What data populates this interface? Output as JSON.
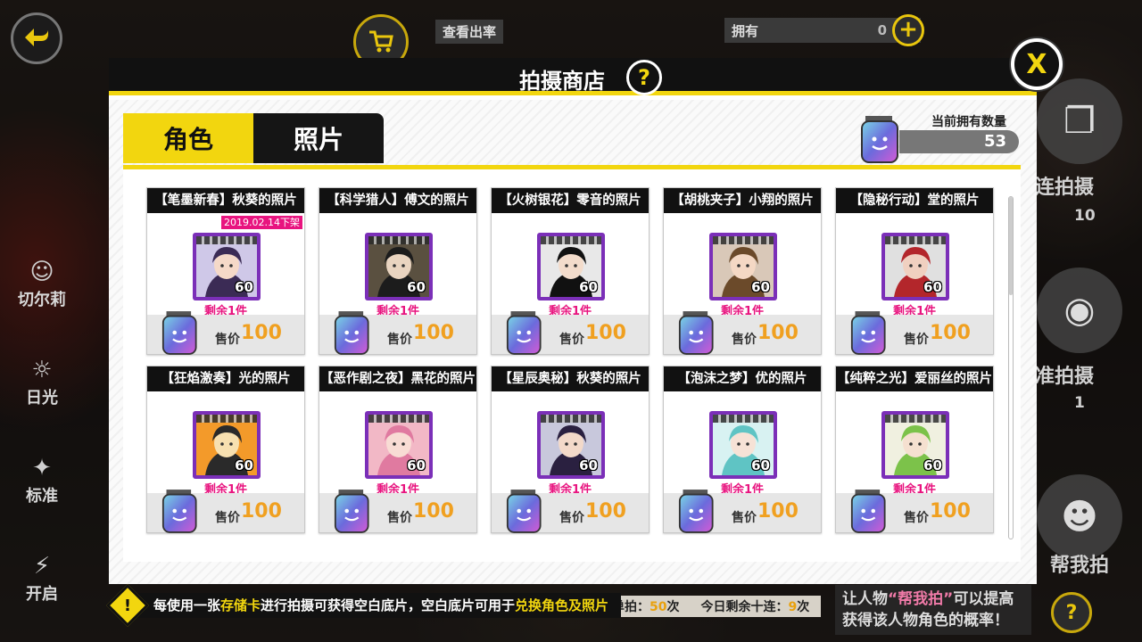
{
  "background": {
    "left_controls": [
      {
        "label": "切尔莉",
        "icon": "character-icon"
      },
      {
        "label": "日光",
        "icon": "sun-icon"
      },
      {
        "label": "标准",
        "icon": "sparkle-icon"
      },
      {
        "label": "开启",
        "icon": "flash-icon"
      }
    ],
    "view_rate_label": "查看出率",
    "owned_label": "拥有",
    "owned_value": "0",
    "right_controls": [
      {
        "label": "十连拍摄",
        "count": "10"
      },
      {
        "label": "标准拍摄",
        "count": "1"
      },
      {
        "label": "帮我拍"
      }
    ],
    "tip_text_pre": "让人物",
    "tip_text_highlight": "“帮我拍”",
    "tip_text_post": "可以提高获得该人物角色的概率！",
    "today_single_label": "今日剩余单拍：",
    "today_single_value": "50",
    "today_ten_label": "今日剩余十连：",
    "today_ten_value": "9",
    "times_unit": "次"
  },
  "modal": {
    "title": "拍摄商店",
    "help": "?",
    "close": "X",
    "tabs": [
      {
        "label": "角色",
        "active": true
      },
      {
        "label": "照片",
        "active": false
      }
    ],
    "owned_count_label": "当前拥有数量",
    "owned_count_value": "53",
    "price_label": "售价",
    "cards": [
      {
        "title": "【笔墨新春】秋葵的照片",
        "badge": "2019.02.14下架",
        "count": "60",
        "remain": "剩余1件",
        "price": "100",
        "palette": [
          "#cfc8e8",
          "#3b2b55",
          "#f5d9c8"
        ]
      },
      {
        "title": "【科学猎人】傅文的照片",
        "badge": "",
        "count": "60",
        "remain": "剩余1件",
        "price": "100",
        "palette": [
          "#5a5040",
          "#1c1c1c",
          "#e9d4c0"
        ]
      },
      {
        "title": "【火树银花】零音的照片",
        "badge": "",
        "count": "60",
        "remain": "剩余1件",
        "price": "100",
        "palette": [
          "#e8e8e8",
          "#111111",
          "#f3dccb"
        ]
      },
      {
        "title": "【胡桃夹子】小翔的照片",
        "badge": "",
        "count": "60",
        "remain": "剩余1件",
        "price": "100",
        "palette": [
          "#d9c8b8",
          "#6b4a2a",
          "#f4d8c4"
        ]
      },
      {
        "title": "【隐秘行动】堂的照片",
        "badge": "",
        "count": "60",
        "remain": "剩余1件",
        "price": "100",
        "palette": [
          "#e0e0e0",
          "#b3262b",
          "#f0d0c0"
        ]
      },
      {
        "title": "【狂焰激奏】光的照片",
        "badge": "",
        "count": "60",
        "remain": "剩余1件",
        "price": "100",
        "palette": [
          "#f39a2a",
          "#2a2a2a",
          "#f7e0b0"
        ]
      },
      {
        "title": "【恶作剧之夜】黑花的照片",
        "badge": "",
        "count": "60",
        "remain": "剩余1件",
        "price": "100",
        "palette": [
          "#f2b8c6",
          "#e07aa0",
          "#f8dcd4"
        ]
      },
      {
        "title": "【星辰奥秘】秋葵的照片",
        "badge": "",
        "count": "60",
        "remain": "剩余1件",
        "price": "100",
        "palette": [
          "#c8c8dc",
          "#2a2040",
          "#f3d9c9"
        ]
      },
      {
        "title": "【泡沫之梦】优的照片",
        "badge": "",
        "count": "60",
        "remain": "剩余1件",
        "price": "100",
        "palette": [
          "#d8f2f2",
          "#5fc4c4",
          "#f6e2d6"
        ]
      },
      {
        "title": "【纯粹之光】爱丽丝的照片",
        "badge": "",
        "count": "60",
        "remain": "剩余1件",
        "price": "100",
        "palette": [
          "#f0f0e0",
          "#7cc24a",
          "#f5e0d0"
        ]
      }
    ],
    "notice_pre": "每使用一张",
    "notice_hl1": "存储卡",
    "notice_mid": "进行拍摄可获得空白底片，空白底片可用于",
    "notice_hl2": "兑换角色及照片"
  },
  "colors": {
    "accent_yellow": "#f2d60f",
    "pink": "#e8147f",
    "price_orange": "#f0a020",
    "portrait_frame": "#7b2fb8"
  }
}
